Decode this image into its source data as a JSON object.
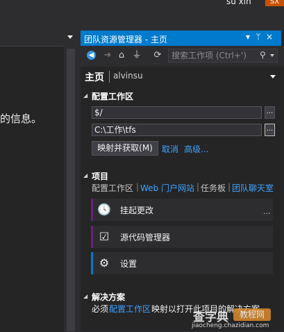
{
  "header": {
    "user_name": "su xin",
    "user_initials": "SX"
  },
  "left_pane": {
    "info_text": "的信息。"
  },
  "window": {
    "title": "团队资源管理器 - 主页",
    "controls": [
      "▾",
      "ᛘ",
      "×"
    ]
  },
  "toolbar": {
    "buttons": [
      "back-icon",
      "forward-icon",
      "home-icon",
      "plug-icon",
      "refresh-icon"
    ],
    "search_placeholder": "搜索工作项 (Ctrl+')"
  },
  "page": {
    "title": "主页",
    "user": "alvinsu"
  },
  "configure_workspace": {
    "section_title": "配置工作区",
    "server_path": "$/",
    "local_path": "C:\\工作\\tfs",
    "browse_label": "...",
    "map_button": "映射并获取(M)",
    "cancel_link": "取消",
    "advanced_link": "高级..."
  },
  "project": {
    "section_title": "项目",
    "links": [
      {
        "label": "配置工作区",
        "style": "grey"
      },
      {
        "label": "Web 门户网站",
        "style": "link"
      },
      {
        "label": "任务板",
        "style": "grey"
      },
      {
        "label": "团队聊天室",
        "style": "link"
      }
    ],
    "cards": [
      {
        "label": "挂起更改",
        "icon": "clock-icon",
        "bar_color": "#68217a",
        "more": "..."
      },
      {
        "label": "源代码管理器",
        "icon": "source-control-icon",
        "bar_color": "#68217a"
      },
      {
        "label": "设置",
        "icon": "gear-icon",
        "bar_color": "#007acc"
      }
    ]
  },
  "solutions": {
    "section_title": "解决方案",
    "text_before": "必须",
    "link": "配置工作区",
    "text_after": "映射以打开此项目的解决方案。"
  },
  "watermark": {
    "line1": "查字典",
    "line2": "教程网",
    "url": "jiaocheng.chazidian.com"
  },
  "colors": {
    "accent": "#007acc",
    "link": "#3ea2ff",
    "background": "#252526"
  }
}
